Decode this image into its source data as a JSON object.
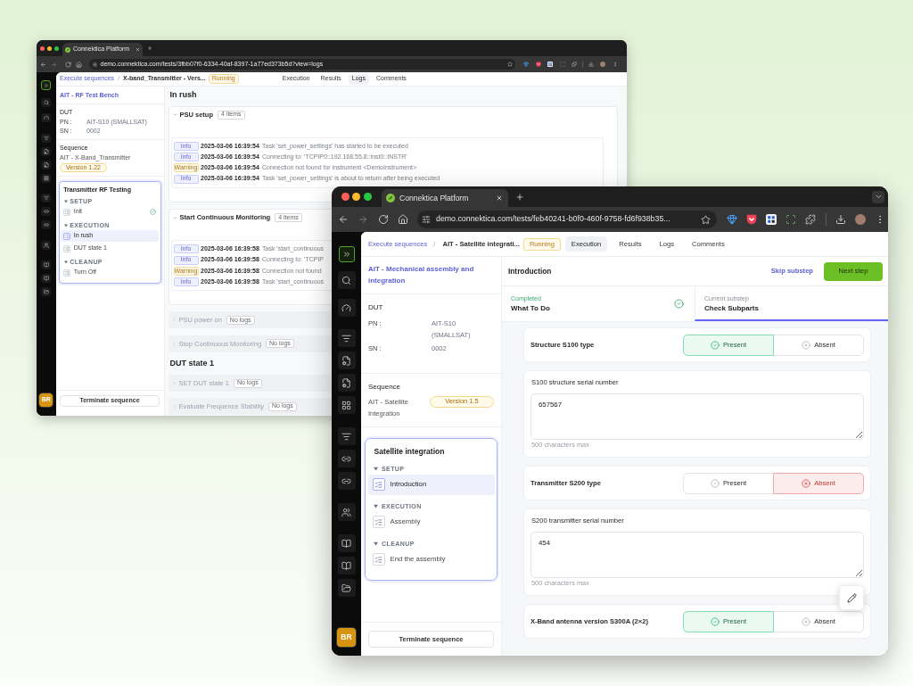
{
  "back_window": {
    "tab": {
      "title": "Connektica Platform"
    },
    "address_bar": {
      "url": "demo.connektica.com/tests/3fbb07f0-6334-40af-8397-1a77ed373b5d?view=logs"
    },
    "user_avatar": "BR",
    "breadcrumb": {
      "link": "Execute sequences",
      "separator": "/",
      "current": "X-band_Transmitter - Vers...",
      "status": "Running"
    },
    "tabs": [
      {
        "label": "Execution",
        "selected": false
      },
      {
        "label": "Results",
        "selected": false
      },
      {
        "label": "Logs",
        "selected": true
      },
      {
        "label": "Comments",
        "selected": false
      }
    ],
    "sidebar": {
      "bench": "AIT - RF Test Bench",
      "dut": {
        "title": "DUT",
        "fields": [
          {
            "label": "PN :",
            "value": "AIT-S10 (SMALLSAT)"
          },
          {
            "label": "SN :",
            "value": "0002"
          }
        ]
      },
      "sequence": {
        "title": "Sequence",
        "name": "AIT - X-Band_Transmitter",
        "version": "Version 1.22"
      },
      "steps": {
        "title": "Transmitter RF Testing",
        "groups": [
          {
            "label": "SETUP",
            "expanded": true,
            "items": [
              {
                "label": "Init",
                "selected": false,
                "completed": true
              }
            ]
          },
          {
            "label": "EXECUTION",
            "expanded": true,
            "items": [
              {
                "label": "In rush",
                "selected": true,
                "completed": false
              },
              {
                "label": "DUT state 1",
                "selected": false,
                "completed": false
              }
            ]
          },
          {
            "label": "CLEANUP",
            "expanded": true,
            "items": [
              {
                "label": "Turn Off",
                "selected": false,
                "completed": false
              }
            ]
          }
        ]
      },
      "terminate_button": "Terminate sequence"
    },
    "logs": [
      {
        "kind": "heading",
        "title": "In rush"
      },
      {
        "kind": "group",
        "title": "PSU setup",
        "expanded": true,
        "count": "4 items",
        "entries": [
          {
            "kind": "info",
            "severity": "Info",
            "time": "2025-03-06 16:39:54",
            "message": "Task 'set_power_settings' has started to be executed"
          },
          {
            "kind": "info",
            "severity": "Info",
            "time": "2025-03-06 16:39:54",
            "message": "Connecting to: 'TCPIP0::192.168.55.8::inst0::INSTR'"
          },
          {
            "kind": "warning",
            "severity": "Warning",
            "time": "2025-03-06 16:39:54",
            "message": "Connection not found for instrument <DemoInstrument>"
          },
          {
            "kind": "info",
            "severity": "Info",
            "time": "2025-03-06 16:39:54",
            "message": "Task 'set_power_settings' is about to return after being executed"
          }
        ]
      },
      {
        "kind": "group",
        "title": "Start Continuous Monitoring",
        "expanded": true,
        "count": "4 items",
        "entries": [
          {
            "kind": "info",
            "severity": "Info",
            "time": "2025-03-06 16:39:58",
            "message": "Task 'start_continuous"
          },
          {
            "kind": "info",
            "severity": "Info",
            "time": "2025-03-06 16:39:58",
            "message": "Connecting to: 'TCPIP"
          },
          {
            "kind": "warning",
            "severity": "Warning",
            "time": "2025-03-06 16:39:58",
            "message": "Connection not found"
          },
          {
            "kind": "info",
            "severity": "Info",
            "time": "2025-03-06 16:39:58",
            "message": "Task 'start_continuous"
          }
        ]
      },
      {
        "kind": "group",
        "title": "PSU power on",
        "expanded": false,
        "count": "No logs"
      },
      {
        "kind": "group",
        "title": "Stop Continuous Monitoring",
        "expanded": false,
        "count": "No logs"
      },
      {
        "kind": "heading",
        "title": "DUT state 1"
      },
      {
        "kind": "group",
        "title": "SET DUT state 1",
        "expanded": false,
        "count": "No logs"
      },
      {
        "kind": "group",
        "title": "Evaluate Frequence Stability",
        "expanded": false,
        "count": "No logs"
      }
    ]
  },
  "front_window": {
    "tab": {
      "title": "Connektica Platform"
    },
    "address_bar": {
      "url": "demo.connektica.com/tests/feb40241-b0f0-460f-9758-fd6f938b35..."
    },
    "user_avatar": "BR",
    "breadcrumb": {
      "link": "Execute sequences",
      "separator": "/",
      "current": "AIT - Satellite integrati...",
      "status": "Running"
    },
    "tabs": [
      {
        "label": "Execution",
        "selected": true
      },
      {
        "label": "Results",
        "selected": false
      },
      {
        "label": "Logs",
        "selected": false
      },
      {
        "label": "Comments",
        "selected": false
      }
    ],
    "sidebar": {
      "bench": "AIT - Mechanical assembly and integration",
      "dut": {
        "title": "DUT",
        "fields": [
          {
            "label": "PN :",
            "value": "AIT-S10 (SMALLSAT)"
          },
          {
            "label": "SN :",
            "value": "0002"
          }
        ]
      },
      "sequence": {
        "title": "Sequence",
        "name": "AIT - Satellite Integration",
        "version": "Version 1.5"
      },
      "steps": {
        "title": "Satellite integration",
        "groups": [
          {
            "label": "SETUP",
            "expanded": true,
            "items": [
              {
                "label": "Introduction",
                "selected": true
              }
            ]
          },
          {
            "label": "EXECUTION",
            "expanded": true,
            "items": [
              {
                "label": "Assembly",
                "selected": false
              }
            ]
          },
          {
            "label": "CLEANUP",
            "expanded": true,
            "items": [
              {
                "label": "End the assembly",
                "selected": false
              }
            ]
          }
        ]
      },
      "terminate_button": "Terminate sequence"
    },
    "step_header": {
      "title": "Introduction",
      "skip_link": "Skip substep",
      "next_button": "Next step"
    },
    "substeps": [
      {
        "kind": "completed",
        "caption": "Completed",
        "title": "What To Do",
        "selected": false
      },
      {
        "kind": "current",
        "caption": "Current substep",
        "title": "Check Subparts",
        "selected": true
      }
    ],
    "form": [
      {
        "kind": "choice",
        "label": "Structure S100 type",
        "options": [
          {
            "kind": "present",
            "label": "Present",
            "selected": true
          },
          {
            "kind": "absent",
            "label": "Absent",
            "selected": false
          }
        ]
      },
      {
        "kind": "text",
        "label": "S100 structure serial number",
        "value": "657567",
        "hint": "500 characters max"
      },
      {
        "kind": "choice",
        "label": "Transmitter S200 type",
        "options": [
          {
            "kind": "present",
            "label": "Present",
            "selected": false
          },
          {
            "kind": "absent",
            "label": "Absent",
            "selected": true
          }
        ]
      },
      {
        "kind": "text",
        "label": "S200 transmitter serial number",
        "value": "454",
        "hint": "500 characters max"
      },
      {
        "kind": "choice",
        "label": "X-Band antenna version S300A (2×2)",
        "options": [
          {
            "kind": "present",
            "label": "Present",
            "selected": true
          },
          {
            "kind": "absent",
            "label": "Absent",
            "selected": false
          }
        ]
      }
    ]
  }
}
